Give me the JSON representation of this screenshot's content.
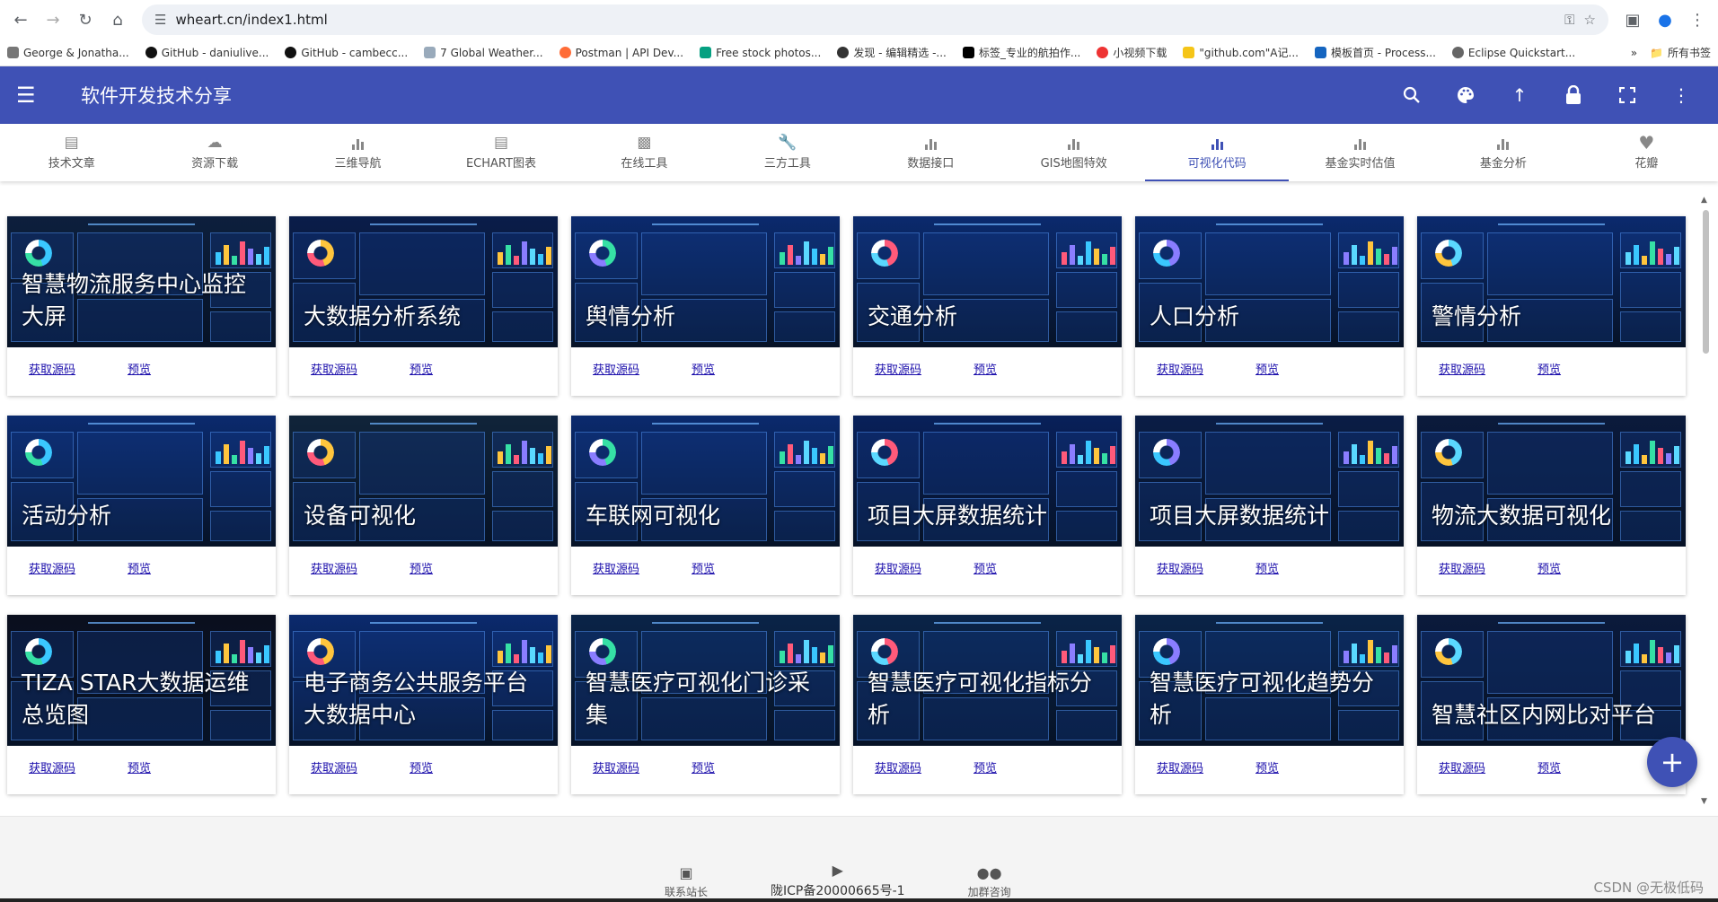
{
  "browser": {
    "url": "wheart.cn/index1.html",
    "bookmarks": [
      "George & Jonatha...",
      "GitHub - daniulive...",
      "GitHub - cambecc...",
      "7 Global Weather...",
      "Postman | API Dev...",
      "Free stock photos...",
      "发现 - 编辑精选 -...",
      "标签_专业的航拍作...",
      "小视频下载",
      "\"github.com\"A记...",
      "模板首页 - Process...",
      "Eclipse Quickstart..."
    ],
    "bookmarks_more": "»",
    "all_bookmarks": "所有书签"
  },
  "appbar": {
    "title": "软件开发技术分享"
  },
  "tabs": [
    {
      "label": "技术文章",
      "icon": "article-icon"
    },
    {
      "label": "资源下载",
      "icon": "cloud-download-icon"
    },
    {
      "label": "三维导航",
      "icon": "chart-icon"
    },
    {
      "label": "ECHART图表",
      "icon": "message-icon"
    },
    {
      "label": "在线工具",
      "icon": "clipboard-icon"
    },
    {
      "label": "三方工具",
      "icon": "wrench-icon"
    },
    {
      "label": "数据接口",
      "icon": "chart-icon"
    },
    {
      "label": "GIS地图特效",
      "icon": "chart-icon"
    },
    {
      "label": "可视化代码",
      "icon": "chart-icon",
      "active": true
    },
    {
      "label": "基金实时估值",
      "icon": "chart-icon"
    },
    {
      "label": "基金分析",
      "icon": "chart-icon"
    },
    {
      "label": "花瓣",
      "icon": "heart-icon"
    }
  ],
  "cards": [
    {
      "title": "智慧物流服务中心监控大屏",
      "source": "获取源码",
      "preview": "预览",
      "theme": "#0d1f3d"
    },
    {
      "title": "大数据分析系统",
      "source": "获取源码",
      "preview": "预览",
      "theme": "#0a1d4a"
    },
    {
      "title": "舆情分析",
      "source": "获取源码",
      "preview": "预览",
      "theme": "#0b2a6e"
    },
    {
      "title": "交通分析",
      "source": "获取源码",
      "preview": "预览",
      "theme": "#0b2a6e"
    },
    {
      "title": "人口分析",
      "source": "获取源码",
      "preview": "预览",
      "theme": "#0b2a6e"
    },
    {
      "title": "警情分析",
      "source": "获取源码",
      "preview": "预览",
      "theme": "#0b2a6e"
    },
    {
      "title": "活动分析",
      "source": "获取源码",
      "preview": "预览",
      "theme": "#0b2a6e"
    },
    {
      "title": "设备可视化",
      "source": "获取源码",
      "preview": "预览",
      "theme": "#10243a"
    },
    {
      "title": "车联网可视化",
      "source": "获取源码",
      "preview": "预览",
      "theme": "#0b2a6e"
    },
    {
      "title": "项目大屏数据统计",
      "source": "获取源码",
      "preview": "预览",
      "theme": "#08205a"
    },
    {
      "title": "项目大屏数据统计",
      "source": "获取源码",
      "preview": "预览",
      "theme": "#0a1d46"
    },
    {
      "title": "物流大数据可视化",
      "source": "获取源码",
      "preview": "预览",
      "theme": "#0b1a3c"
    },
    {
      "title": "TIZA STAR大数据运维总览图",
      "source": "获取源码",
      "preview": "预览",
      "theme": "#0a0f1e"
    },
    {
      "title": "电子商务公共服务平台大数据中心",
      "source": "获取源码",
      "preview": "预览",
      "theme": "#0b2a6e"
    },
    {
      "title": "智慧医疗可视化门诊采集",
      "source": "获取源码",
      "preview": "预览",
      "theme": "#0a2448"
    },
    {
      "title": "智慧医疗可视化指标分析",
      "source": "获取源码",
      "preview": "预览",
      "theme": "#0a2448"
    },
    {
      "title": "智慧医疗可视化趋势分析",
      "source": "获取源码",
      "preview": "预览",
      "theme": "#0a2448"
    },
    {
      "title": "智慧社区内网比对平台",
      "source": "获取源码",
      "preview": "预览",
      "theme": "#0b1a3c"
    }
  ],
  "fab": {
    "label": "+"
  },
  "footer": {
    "contact": "联系站长",
    "icp": "陇ICP备20000665号-1",
    "group": "加群咨询",
    "watermark": "CSDN @无极低码"
  },
  "colors": {
    "primary": "#3f51b5",
    "link": "#1a0dab"
  }
}
